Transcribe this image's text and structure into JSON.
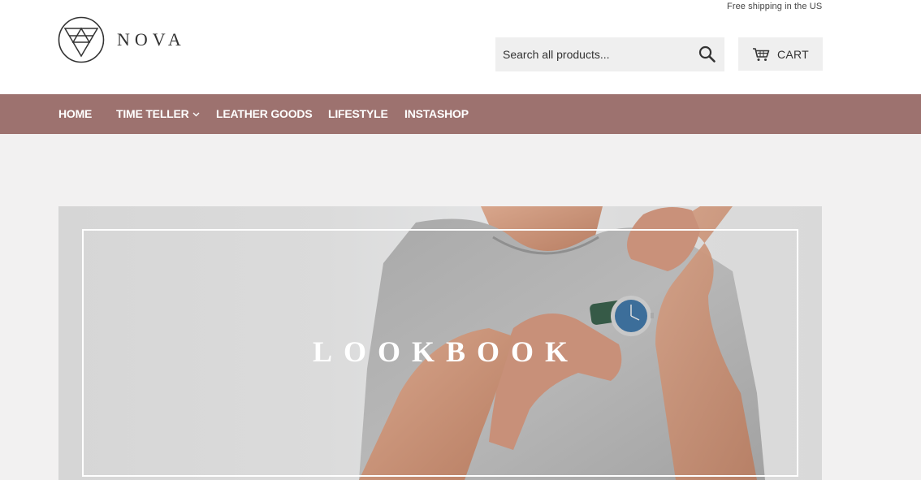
{
  "header": {
    "announcement": "Free shipping in the US",
    "logo_text": "NOVA",
    "search": {
      "placeholder": "Search all products..."
    },
    "cart_label": "CART"
  },
  "nav": {
    "items": [
      {
        "label": "HOME"
      },
      {
        "label": "TIME TELLER",
        "has_dropdown": true
      },
      {
        "label": "LEATHER GOODS"
      },
      {
        "label": "LIFESTYLE"
      },
      {
        "label": "INSTASHOP"
      }
    ]
  },
  "hero": {
    "title": "LOOKBOOK"
  },
  "colors": {
    "nav_background": "#9d726f",
    "page_background": "#f2f1f1",
    "header_background": "#ffffff",
    "control_background": "#efefef",
    "watch_face": "#3c6e9a",
    "watch_strap": "#365a47"
  },
  "icons": {
    "logo": "geometric-circle-triangles-icon",
    "search": "search-icon",
    "cart": "cart-icon",
    "dropdown": "chevron-down-icon"
  }
}
